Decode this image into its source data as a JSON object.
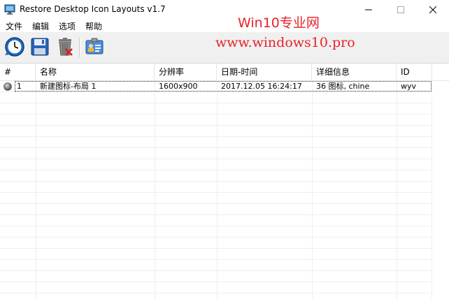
{
  "window": {
    "title": "Restore Desktop Icon Layouts v1.7"
  },
  "watermark": {
    "line1": "Win10专业网",
    "line2": "www.windows10.pro"
  },
  "menu": [
    "文件",
    "编辑",
    "选项",
    "帮助"
  ],
  "toolbar": {
    "buttons": [
      "restore-icon",
      "save-icon",
      "delete-icon",
      "properties-icon"
    ]
  },
  "columns": [
    "#",
    "名称",
    "分辨率",
    "日期-时间",
    "详细信息",
    "ID"
  ],
  "rows": [
    {
      "num": "1",
      "name": "新建图标-布局 1",
      "resolution": "1600x900",
      "datetime": "2017.12.05 16:24:17",
      "details": "36 图标, chine",
      "id": "wyv"
    }
  ],
  "colors": {
    "watermark": "#e8222a",
    "toolbar_bg": "#f0f0f0"
  }
}
